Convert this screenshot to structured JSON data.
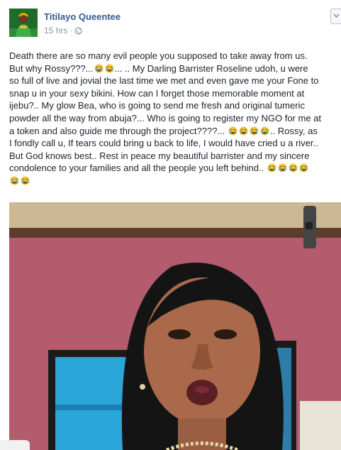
{
  "post": {
    "author": "Titilayo Queentee",
    "time": "15 hrs",
    "separator": "·",
    "body_lines": [
      "Death there are so many evil people you supposed to take away from us.",
      "But why Rossy???...",
      "... .. My Darling Barrister Roseline udoh, u were",
      "so full of live and jovial the last time we met and even gave me your Fone to",
      "snap u in your sexy bikini. How can I forget those memorable moment at",
      "ijebu?.. My glow Bea, who is going to send me fresh and original tumeric",
      "powder all the way from abuja?... Who is going to register my NGO for me at",
      "a token and also guide me through the project????...",
      ".. Rossy, as",
      "I fondly call u, If tears could bring u back to life, I would have cried u a river..",
      "But God knows best.. Rest in peace my beautiful barrister and my sincere",
      "condolence to your families and all the people you left behind.."
    ],
    "emoji_name": "loudly-crying-face-emoji"
  },
  "colors": {
    "author_link": "#365899",
    "meta_gray": "#90949c",
    "text": "#1d2129",
    "emoji_yellow": "#f7c531",
    "wall_pink": "#b35a6c"
  }
}
